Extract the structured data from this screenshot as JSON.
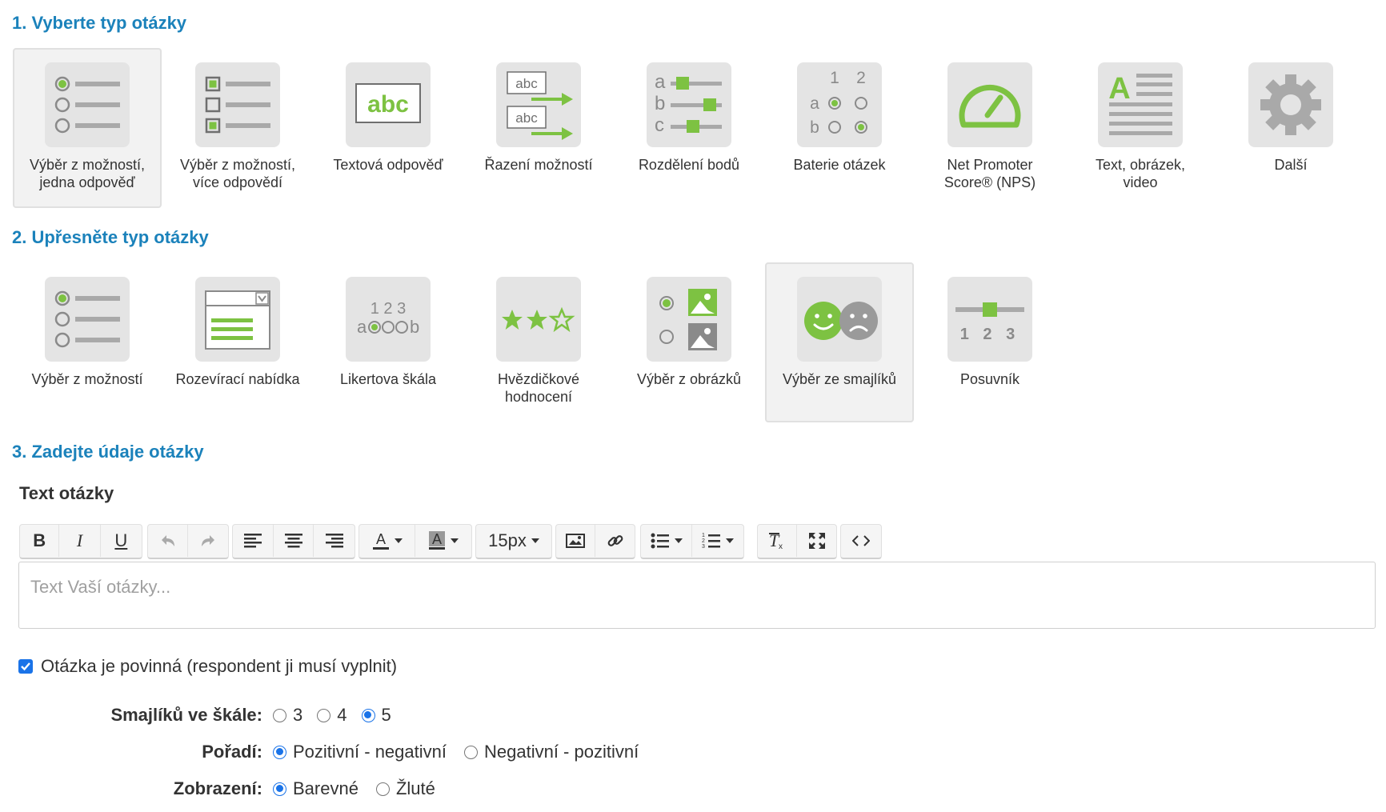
{
  "section1": {
    "title": "1. Vyberte typ otázky",
    "tiles": [
      {
        "label": "Výběr z možností,\njedna odpověď",
        "icon": "single-choice-icon",
        "selected": true
      },
      {
        "label": "Výběr z možností,\nvíce odpovědí",
        "icon": "multiple-choice-icon"
      },
      {
        "label": "Textová odpověď",
        "icon": "text-answer-icon",
        "icon_text": "abc"
      },
      {
        "label": "Řazení možností",
        "icon": "ordering-icon",
        "icon_text": "abc"
      },
      {
        "label": "Rozdělení bodů",
        "icon": "points-distribution-icon",
        "icon_letters": [
          "a",
          "b",
          "c"
        ]
      },
      {
        "label": "Baterie otázek",
        "icon": "question-battery-icon",
        "icon_letters": [
          "1",
          "2",
          "a",
          "b"
        ]
      },
      {
        "label": "Net Promoter\nScore® (NPS)",
        "icon": "nps-gauge-icon"
      },
      {
        "label": "Text, obrázek,\nvideo",
        "icon": "text-image-video-icon",
        "icon_text": "A"
      },
      {
        "label": "Další",
        "icon": "gear-icon"
      }
    ]
  },
  "section2": {
    "title": "2. Upřesněte typ otázky",
    "tiles": [
      {
        "label": "Výběr z možností",
        "icon": "radio-list-icon"
      },
      {
        "label": "Rozevírací nabídka",
        "icon": "dropdown-icon"
      },
      {
        "label": "Likertova škála",
        "icon": "likert-scale-icon",
        "icon_text": "1 2 3"
      },
      {
        "label": "Hvězdičkové\nhodnocení",
        "icon": "star-rating-icon"
      },
      {
        "label": "Výběr z obrázků",
        "icon": "image-choice-icon"
      },
      {
        "label": "Výběr ze smajlíků",
        "icon": "smiley-icon",
        "selected": true
      },
      {
        "label": "Posuvník",
        "icon": "slider-icon",
        "icon_text": "1 2 3"
      }
    ]
  },
  "section3": {
    "title": "3. Zadejte údaje otázky",
    "field_title": "Text otázky",
    "toolbar": {
      "font_size": "15px",
      "buttons": [
        "bold",
        "italic",
        "underline",
        "undo",
        "redo",
        "align-left",
        "align-center",
        "align-right",
        "text-color",
        "background-color",
        "font-size",
        "insert-image",
        "insert-link",
        "bulleted-list",
        "numbered-list",
        "clear-formatting",
        "fullscreen",
        "source-code"
      ]
    },
    "editor_placeholder": "Text Vaší otázky...",
    "required": {
      "label": "Otázka je povinná (respondent ji musí vyplnit)",
      "checked": true
    },
    "options": {
      "scale": {
        "label": "Smajlíků ve škále:",
        "choices": [
          "3",
          "4",
          "5"
        ],
        "selected": "5"
      },
      "order": {
        "label": "Pořadí:",
        "choices": [
          "Pozitivní - negativní",
          "Negativní - pozitivní"
        ],
        "selected": "Pozitivní - negativní"
      },
      "display": {
        "label": "Zobrazení:",
        "choices": [
          "Barevné",
          "Žluté"
        ],
        "selected": "Barevné"
      }
    }
  },
  "colors": {
    "accent_title": "#1b82bb",
    "icon_green": "#7dc242",
    "icon_grey": "#cfcfcf",
    "check_blue": "#1a73e8"
  }
}
